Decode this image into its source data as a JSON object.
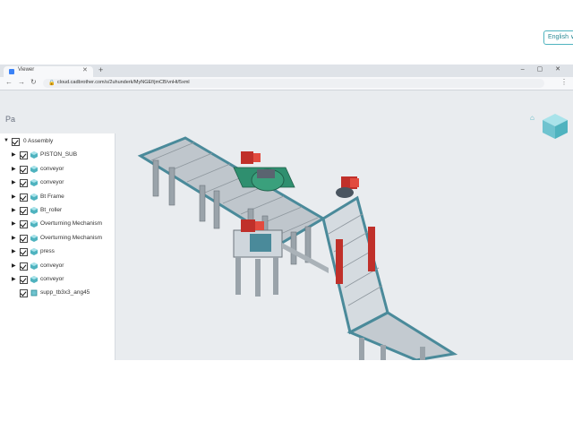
{
  "browser": {
    "tab_title": "Viewer",
    "url": "cloud.cadbrother.com/s/2uhunderk/MyNGEf/jmCB/vnHt/5xml",
    "nav": {
      "back": "←",
      "forward": "→",
      "reload": "↻"
    },
    "new_tab": "+",
    "window_controls": "– ▢ ✕",
    "menu": "⋮"
  },
  "app": {
    "logo_text": "Pa",
    "language": "English ∨"
  },
  "tree": {
    "root": "0 Assembly",
    "items": [
      {
        "label": "PISTON_SUB",
        "icon": "part-icon",
        "expandable": true
      },
      {
        "label": "conveyor",
        "icon": "part-icon",
        "expandable": true
      },
      {
        "label": "conveyor",
        "icon": "part-icon",
        "expandable": true
      },
      {
        "label": "Bt Frame",
        "icon": "part-icon",
        "expandable": true
      },
      {
        "label": "Bt_roller",
        "icon": "part-icon",
        "expandable": true
      },
      {
        "label": "Overturning Mechanism",
        "icon": "part-icon",
        "expandable": true
      },
      {
        "label": "Overturning Mechanism",
        "icon": "part-icon",
        "expandable": true
      },
      {
        "label": "press",
        "icon": "part-icon",
        "expandable": true
      },
      {
        "label": "conveyor",
        "icon": "part-icon",
        "expandable": true
      },
      {
        "label": "conveyor",
        "icon": "part-icon",
        "expandable": true
      },
      {
        "label": "supp_tb3x3_ang45",
        "icon": "body-icon",
        "expandable": false
      }
    ]
  },
  "colors": {
    "accent": "#4fb3bf",
    "conveyor_teal": "#4a8a9a",
    "frame_grey": "#9aa3aa",
    "motor_red": "#c0302a",
    "gear_green": "#2f8f6f"
  }
}
